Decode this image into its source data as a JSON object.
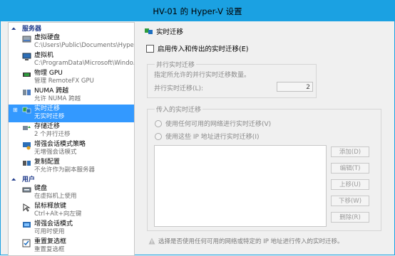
{
  "window": {
    "title": "HV-01 的 Hyper-V 设置"
  },
  "sidebar": {
    "sections": [
      {
        "label": "服务器"
      },
      {
        "label": "用户"
      }
    ],
    "items": [
      {
        "name": "虚拟硬盘",
        "sub": "C:\\Users\\Public\\Documents\\Hyper-...",
        "icon": "virtual-disk-icon"
      },
      {
        "name": "虚拟机",
        "sub": "C:\\ProgramData\\Microsoft\\Windo...",
        "icon": "virtual-machine-icon"
      },
      {
        "name": "物理 GPU",
        "sub": "管理 RemoteFX GPU",
        "icon": "gpu-icon"
      },
      {
        "name": "NUMA 跨越",
        "sub": "允许 NUMA 跨越",
        "icon": "numa-icon"
      },
      {
        "name": "实时迁移",
        "sub": "无实时迁移",
        "icon": "live-migration-icon",
        "expand": "⊞"
      },
      {
        "name": "存储迁移",
        "sub": "2 个并行迁移",
        "icon": "storage-migration-icon"
      },
      {
        "name": "增强会话模式策略",
        "sub": "无增强会话模式",
        "icon": "enhanced-session-policy-icon"
      },
      {
        "name": "复制配置",
        "sub": "不允许作为副本服务器",
        "icon": "replication-icon"
      },
      {
        "name": "键盘",
        "sub": "在虚拟机上使用",
        "icon": "keyboard-icon"
      },
      {
        "name": "鼠标释放键",
        "sub": "Ctrl+Alt+向左键",
        "icon": "mouse-release-icon"
      },
      {
        "name": "增强会话模式",
        "sub": "可用时使用",
        "icon": "enhanced-session-icon"
      },
      {
        "name": "重置复选框",
        "sub": "重置复选框",
        "icon": "reset-checkbox-icon"
      }
    ]
  },
  "main": {
    "header": "实时迁移",
    "enable_checkbox_label": "启用传入和传出的实时迁移(E)",
    "parallel": {
      "group_label": "并行实时迁移",
      "description": "指定所允许的并行实时迁移数量。",
      "field_label": "并行实时迁移(L):",
      "field_value": "2"
    },
    "incoming": {
      "group_label": "传入的实时迁移",
      "radio_any": "使用任何可用的网络进行实时迁移(V)",
      "radio_these": "使用这些 IP 地址进行实时迁移(I)",
      "buttons": [
        "添加(D)",
        "编辑(T)",
        "上移(U)",
        "下移(W)",
        "删除(R)"
      ]
    },
    "note": "选择是否使用任何可用的网络或特定的 IP 地址进行传入的实时迁移。"
  },
  "colors": {
    "titlebar": "#1ba1e2",
    "selection": "#3399ff",
    "section_text": "#1f3a8a"
  }
}
